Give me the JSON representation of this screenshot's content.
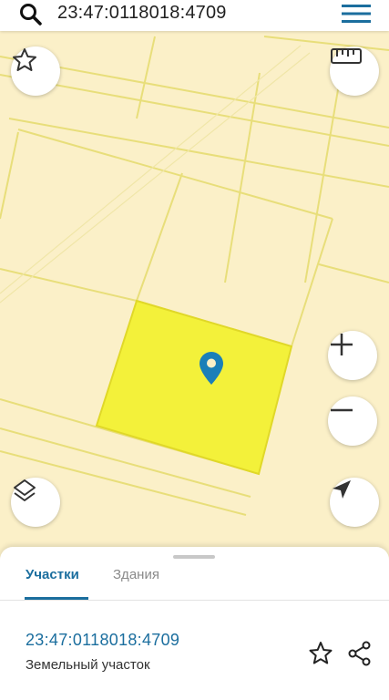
{
  "search": {
    "query": "23:47:0118018:4709",
    "search_icon": "search-icon",
    "menu_icon": "hamburger-menu-icon"
  },
  "map": {
    "background_color": "#fbf0c8",
    "boundary_color": "#e8de7a",
    "selected_parcel_color": "#f3f13a",
    "marker_color": "#1b7fb8",
    "controls": {
      "favorite_icon": "star-icon",
      "ruler_icon": "ruler-icon",
      "zoom_in_icon": "plus-icon",
      "zoom_out_icon": "minus-icon",
      "layers_icon": "layers-icon",
      "locate_icon": "navigation-arrow-icon"
    }
  },
  "bottom_sheet": {
    "tabs": [
      {
        "label": "Участки",
        "active": true
      },
      {
        "label": "Здания",
        "active": false
      }
    ],
    "accent_color": "#1b6e9e",
    "parcel": {
      "cadastral_number": "23:47:0118018:4709",
      "type": "Земельный участок",
      "favorite_icon": "star-icon",
      "share_icon": "share-icon"
    }
  }
}
